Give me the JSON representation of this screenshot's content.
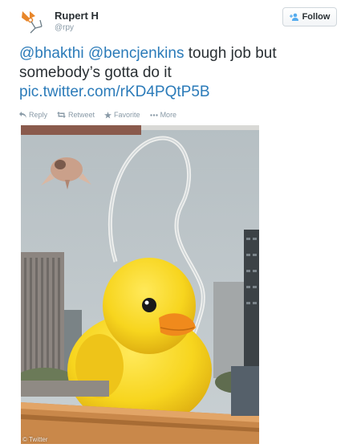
{
  "user": {
    "display_name": "Rupert H",
    "handle": "@rpy",
    "avatar_icon": "stick-figure-logo-icon"
  },
  "follow_button": {
    "label": "Follow",
    "icon": "add-user-icon"
  },
  "tweet": {
    "mention_1": "@bhakthi",
    "mention_2": "@bencjenkins",
    "text": "tough job but somebody’s gotta do it",
    "link": "pic.twitter.com/rKD4PQtP5B"
  },
  "actions": {
    "reply": "Reply",
    "retweet": "Retweet",
    "favorite": "Favorite",
    "more": "More"
  },
  "photo": {
    "subject": "giant yellow rubber duck",
    "watermark": "© Twitter"
  },
  "colors": {
    "link_blue": "#2b7bb9",
    "muted_gray": "#8899a6",
    "text_dark": "#292f33",
    "avatar_orange": "#e8862a",
    "duck_yellow": "#f7d51e",
    "beak_orange": "#f08a1c"
  }
}
